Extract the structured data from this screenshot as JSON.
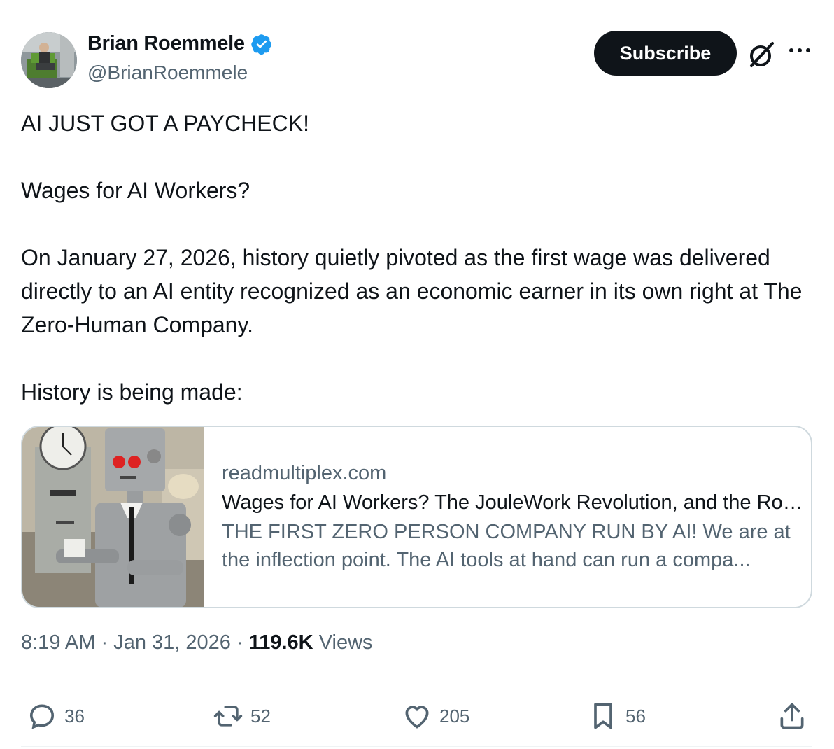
{
  "author": {
    "display_name": "Brian Roemmele",
    "handle": "@BrianRoemmele",
    "verified": true
  },
  "header": {
    "subscribe_label": "Subscribe",
    "grok_icon": "slashed-circle-icon",
    "more_icon": "more-dots-icon"
  },
  "tweet": {
    "paragraphs": [
      "AI JUST GOT A PAYCHECK!",
      "Wages for AI Workers?",
      "On January 27, 2026, history quietly pivoted as the first wage was delivered directly to an AI entity recognized as an economic earner in its own right at The Zero-Human Company.",
      "History is being made:"
    ]
  },
  "card": {
    "domain": "readmultiplex.com",
    "title": "Wages for AI Workers? The JouleWork Revolution, and the Road to a Zero-Human Company",
    "description_line1": "THE FIRST ZERO PERSON COMPANY RUN BY AI! We are at",
    "description_line2": "the inflection point. The AI tools at hand can run a compa..."
  },
  "meta": {
    "time": "8:19 AM",
    "sep": "·",
    "date": "Jan 31, 2026",
    "views_count": "119.6K",
    "views_label": "Views"
  },
  "actions": {
    "replies": "36",
    "reposts": "52",
    "likes": "205",
    "bookmarks": "56"
  },
  "colors": {
    "text": "#0f1419",
    "secondary": "#536471",
    "verified_blue": "#1d9bf0",
    "border": "#cfd9de"
  }
}
